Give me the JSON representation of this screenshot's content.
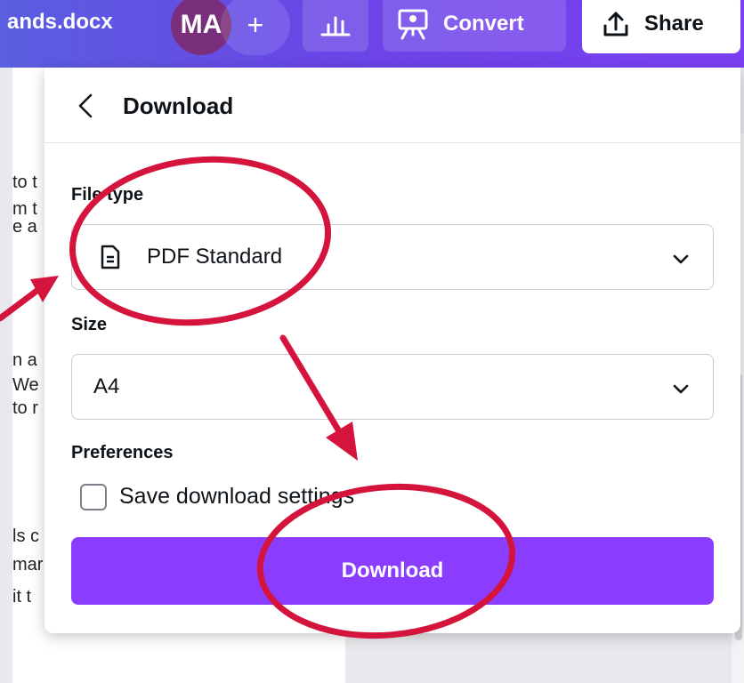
{
  "topbar": {
    "doc_title": "ands.docx",
    "avatar_initials": "MA",
    "add_label": "+",
    "convert_label": "Convert",
    "share_label": "Share"
  },
  "background_page": {
    "fragments": [
      "to t",
      "m t",
      "e a",
      "n a",
      "We",
      "to r",
      "ls c",
      "mar",
      "it t"
    ]
  },
  "panel": {
    "title": "Download",
    "file_type_label": "File type",
    "file_type_value": "PDF Standard",
    "size_label": "Size",
    "size_value": "A4",
    "preferences_label": "Preferences",
    "save_settings_label": "Save download settings",
    "download_button": "Download"
  },
  "colors": {
    "accent": "#8b3dff",
    "annotation": "#d4143c"
  }
}
